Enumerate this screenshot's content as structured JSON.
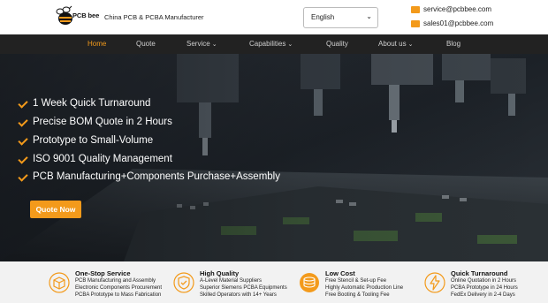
{
  "header": {
    "logo_text": "PCB bee",
    "tagline": "China PCB & PCBA Manufacturer",
    "language": "English",
    "emails": [
      "service@pcbbee.com",
      "sales01@pcbbee.com"
    ]
  },
  "nav": [
    {
      "label": "Home",
      "active": true
    },
    {
      "label": "Quote"
    },
    {
      "label": "Service",
      "dropdown": true
    },
    {
      "label": "Capabilities",
      "dropdown": true
    },
    {
      "label": "Quality"
    },
    {
      "label": "About us",
      "dropdown": true
    },
    {
      "label": "Blog"
    }
  ],
  "hero": {
    "features": [
      "1 Week Quick Turnaround",
      "Precise BOM Quote in 2 Hours",
      "Prototype to Small-Volume",
      "ISO 9001 Quality Management",
      "PCB Manufacturing+Components Purchase+Assembly"
    ],
    "cta": "Quote Now"
  },
  "highlights": [
    {
      "title": "One-Stop Service",
      "icon": "box-icon",
      "lines": [
        "PCB Manufacturing and Assembly",
        "Electronic Components Procurement",
        "PCBA Prototype to Mass Fabrication"
      ]
    },
    {
      "title": "High Quality",
      "icon": "shield-check-icon",
      "lines": [
        "A-Level Material Suppliers",
        "Superior Siemens PCBA Equipments",
        "Skilled Operators with 14+ Years"
      ]
    },
    {
      "title": "Low Cost",
      "icon": "coins-icon",
      "lines": [
        "Free Stencil & Set-up Fee",
        "Highly Automatic Production Line",
        "Free Booting & Tooling Fee"
      ]
    },
    {
      "title": "Quick Turnaround",
      "icon": "lightning-icon",
      "lines": [
        "Online Quotation in 2 Hours",
        "PCBA Prototype in 24 Hours",
        "FedEx Delivery in 2-4 Days"
      ]
    }
  ],
  "colors": {
    "accent": "#f39a1b",
    "nav_bg": "#222222"
  }
}
